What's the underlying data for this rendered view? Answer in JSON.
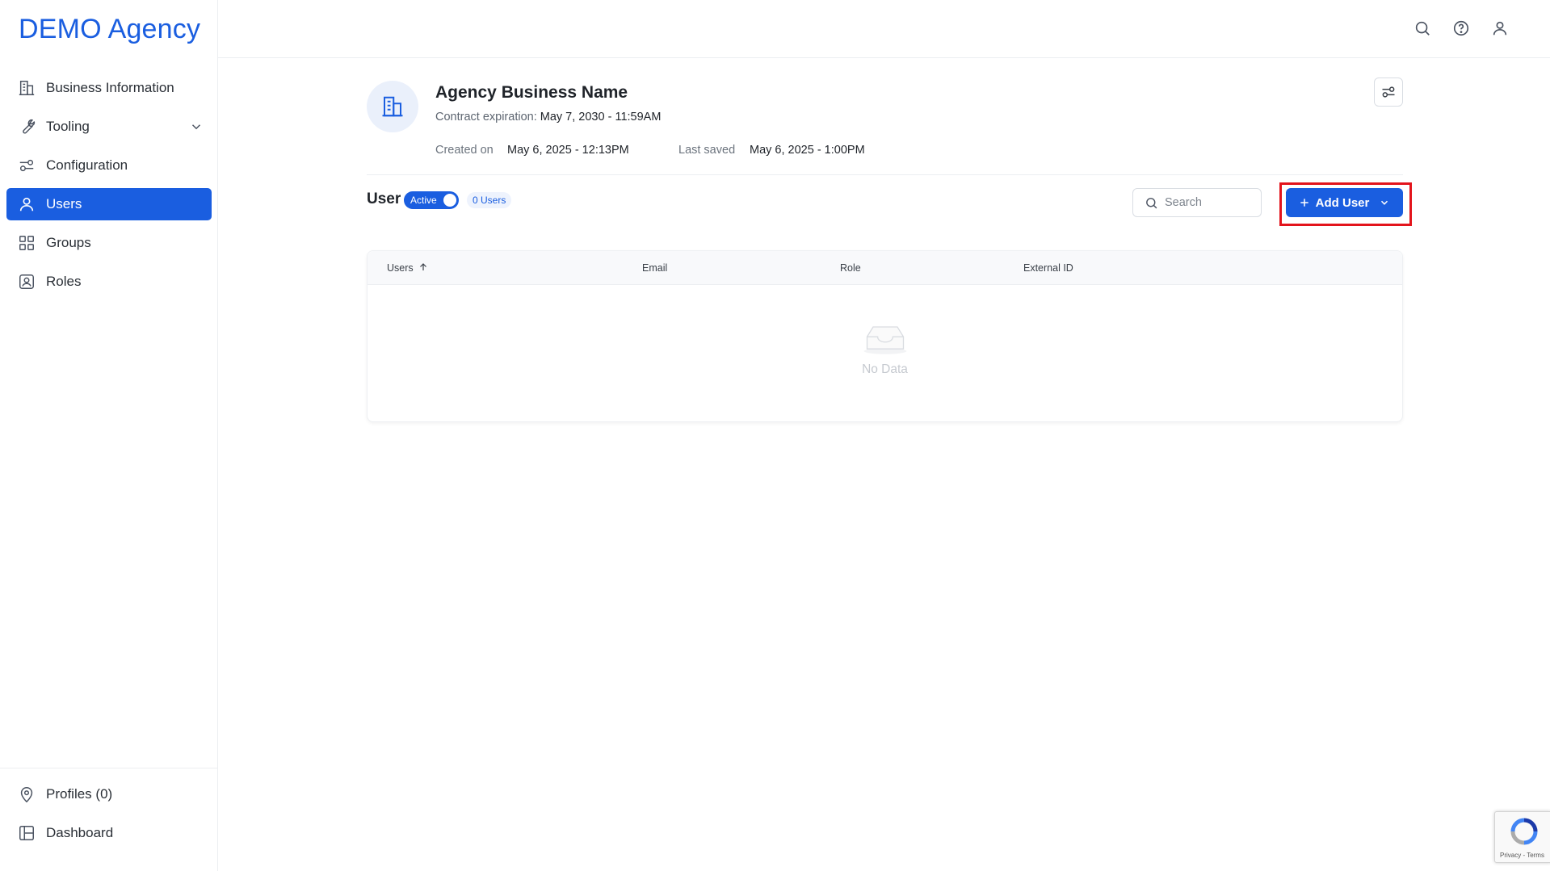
{
  "brand": "DEMO Agency",
  "sidebar": {
    "items": [
      {
        "label": "Business Information",
        "icon": "building-icon"
      },
      {
        "label": "Tooling",
        "icon": "wrench-icon"
      },
      {
        "label": "Configuration",
        "icon": "sliders-icon"
      },
      {
        "label": "Users",
        "icon": "user-icon",
        "active": true
      },
      {
        "label": "Groups",
        "icon": "grid-icon"
      },
      {
        "label": "Roles",
        "icon": "id-badge-icon"
      }
    ],
    "bottom_items": [
      {
        "label": "Profiles (0)",
        "icon": "map-pin-icon"
      },
      {
        "label": "Dashboard",
        "icon": "dashboard-icon"
      }
    ]
  },
  "header": {
    "business_name": "Agency Business Name",
    "contract_label": "Contract expiration:",
    "contract_value": "May 7, 2030 - 11:59AM",
    "created_label": "Created on",
    "created_value": "May 6, 2025 - 12:13PM",
    "saved_label": "Last saved",
    "saved_value": "May 6, 2025 - 1:00PM"
  },
  "users_section": {
    "title": "User",
    "toggle_label": "Active",
    "count_badge": "0 Users",
    "search_placeholder": "Search",
    "add_button_label": "Add User"
  },
  "table": {
    "columns": [
      "Users",
      "Email",
      "Role",
      "External ID"
    ],
    "rows": [],
    "empty_text": "No Data"
  },
  "recaptcha": {
    "text": "Privacy - Terms"
  },
  "colors": {
    "accent": "#1a5ee0",
    "highlight": "#e3141c"
  }
}
